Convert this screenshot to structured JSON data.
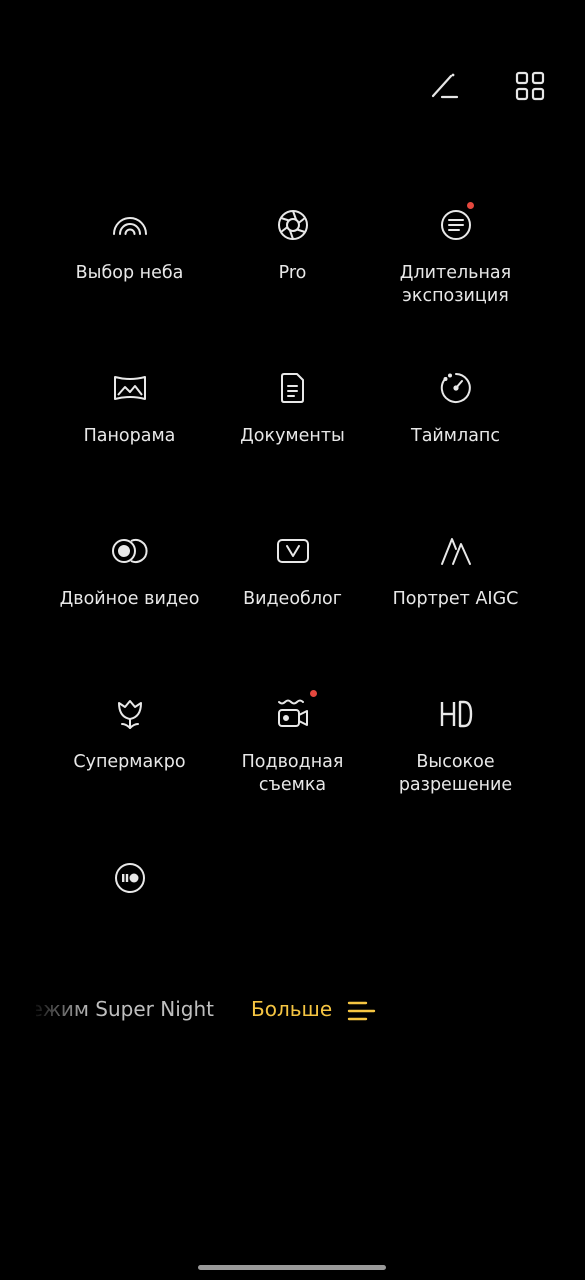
{
  "header": {
    "edit_icon": "edit-pencil-icon",
    "grid_icon": "grid-layout-icon"
  },
  "modes": [
    {
      "label": "Выбор неба",
      "icon": "rainbow-sky-icon",
      "new_badge": false
    },
    {
      "label": "Pro",
      "icon": "aperture-icon",
      "new_badge": false
    },
    {
      "label": "Длительная\nэкспозиция",
      "icon": "long-exposure-icon",
      "new_badge": true
    },
    {
      "label": "Панорама",
      "icon": "panorama-icon",
      "new_badge": false
    },
    {
      "label": "Документы",
      "icon": "document-icon",
      "new_badge": false
    },
    {
      "label": "Таймлапс",
      "icon": "timelapse-icon",
      "new_badge": false
    },
    {
      "label": "Двойное видео",
      "icon": "dual-video-icon",
      "new_badge": false
    },
    {
      "label": "Видеоблог",
      "icon": "vlog-icon",
      "new_badge": false
    },
    {
      "label": "Портрет AIGC",
      "icon": "aigc-portrait-icon",
      "new_badge": false
    },
    {
      "label": "Супермакро",
      "icon": "supermacro-flower-icon",
      "new_badge": false
    },
    {
      "label": "Подводная\nсъемка",
      "icon": "underwater-camera-icon",
      "new_badge": true
    },
    {
      "label": "Высокое\nразрешение",
      "icon": "hd-icon",
      "new_badge": false
    },
    {
      "label": "",
      "icon": "record-icon",
      "new_badge": false
    }
  ],
  "mode_strip": {
    "previous": "Режим Super Night",
    "current": "Больше",
    "current_icon": "more-menu-icon"
  },
  "colors": {
    "background": "#000000",
    "accent": "#f5c542",
    "badge": "#e5483e",
    "text": "#e8e8e8"
  }
}
